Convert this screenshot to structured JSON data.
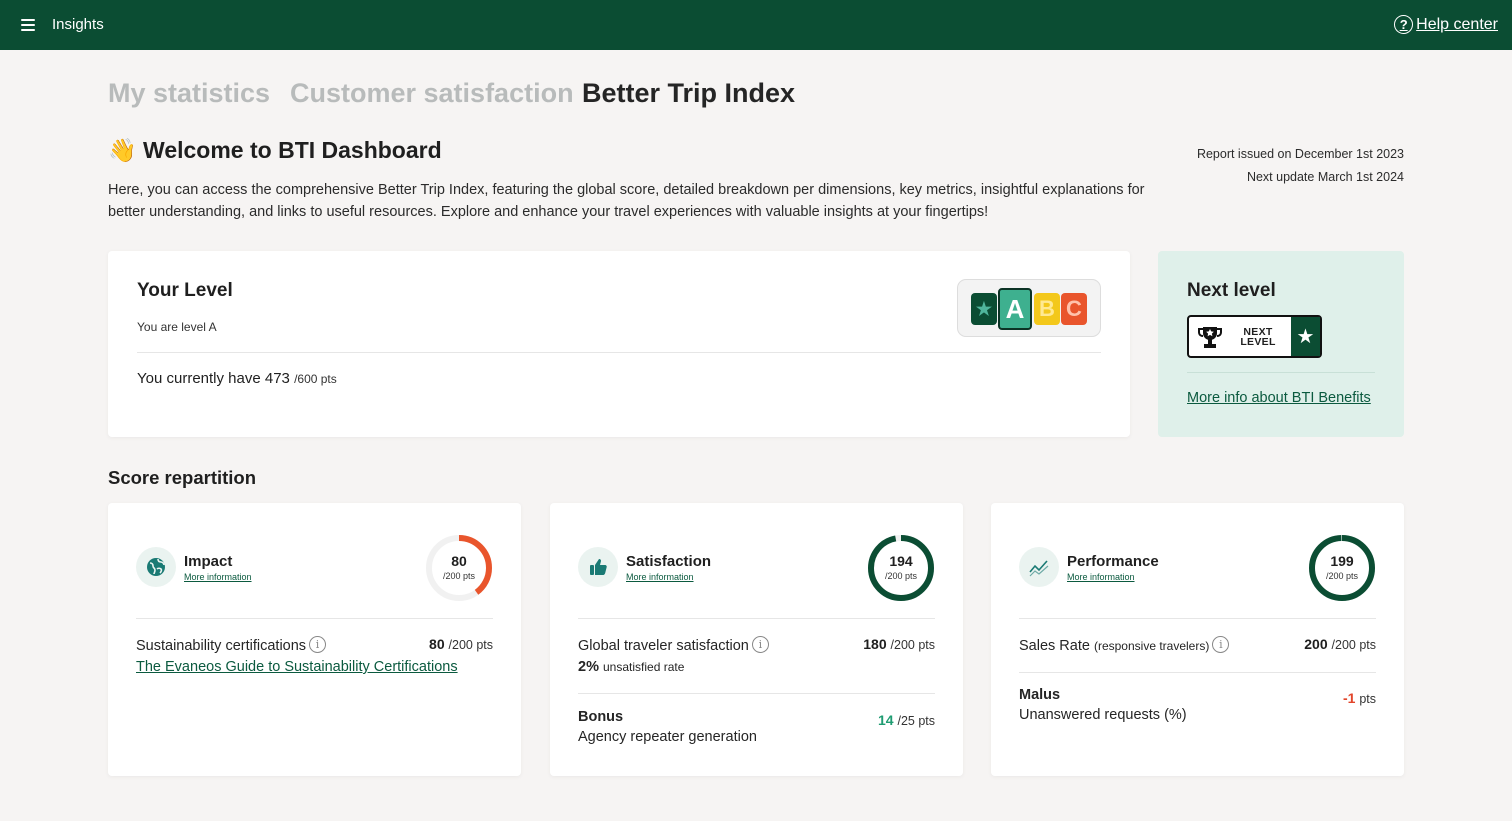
{
  "header": {
    "app_title": "Insights",
    "help_label": "Help center",
    "help_icon": "?"
  },
  "tabs": [
    {
      "label": "My statistics",
      "active": false
    },
    {
      "label": "Customer satisfaction",
      "active": false
    },
    {
      "label": "Better Trip Index",
      "active": true
    }
  ],
  "welcome": {
    "emoji": "👋",
    "title": "Welcome to BTI Dashboard",
    "report_issued": "Report issued on December 1st 2023",
    "next_update": "Next update March 1st 2024",
    "intro": "Here, you can access the comprehensive Better Trip Index, featuring the global score, detailed breakdown per dimensions, key metrics, insightful explanations for better understanding, and links to useful resources. Explore and enhance your travel experiences with valuable insights at your fingertips!"
  },
  "level": {
    "title": "Your Level",
    "subtitle": "You are level A",
    "points_text": "You currently have 473",
    "points_max": "/600 pts",
    "badges": [
      "A",
      "B",
      "C"
    ],
    "current": "A"
  },
  "next_level": {
    "title": "Next level",
    "badge_text_1": "NEXT",
    "badge_text_2": "LEVEL",
    "link": "More info about BTI Benefits"
  },
  "score_section": {
    "title": "Score repartition",
    "cards": [
      {
        "name": "Impact",
        "more": "More information",
        "value": "80",
        "max": "/200 pts",
        "fraction": 0.4,
        "ring_color": "#e9552c",
        "rows": [
          {
            "label": "Sustainability certifications",
            "value": "80",
            "max": "/200 pts"
          }
        ],
        "link": "The Evaneos Guide to Sustainability Certifications"
      },
      {
        "name": "Satisfaction",
        "more": "More information",
        "value": "194",
        "max": "/200 pts",
        "fraction": 0.97,
        "ring_color": "#0b4d33",
        "rows": [
          {
            "label": "Global traveler satisfaction",
            "value": "180",
            "max": "/200 pts",
            "sub_value": "2%",
            "sub_label": "unsatisfied rate"
          },
          {
            "label": "Bonus",
            "detail": "Agency repeater generation",
            "value": "14",
            "max": "/25 pts"
          }
        ]
      },
      {
        "name": "Performance",
        "more": "More information",
        "value": "199",
        "max": "/200 pts",
        "fraction": 0.995,
        "ring_color": "#0b4d33",
        "rows": [
          {
            "label": "Sales Rate",
            "label_small": "(responsive travelers)",
            "value": "200",
            "max": "/200 pts"
          },
          {
            "label": "Malus",
            "detail": "Unanswered requests (%)",
            "value": "-1",
            "max": "pts"
          }
        ]
      }
    ]
  },
  "colors": {
    "brand": "#0b4d33",
    "accent": "#1f9c72",
    "negative": "#e2452b"
  }
}
